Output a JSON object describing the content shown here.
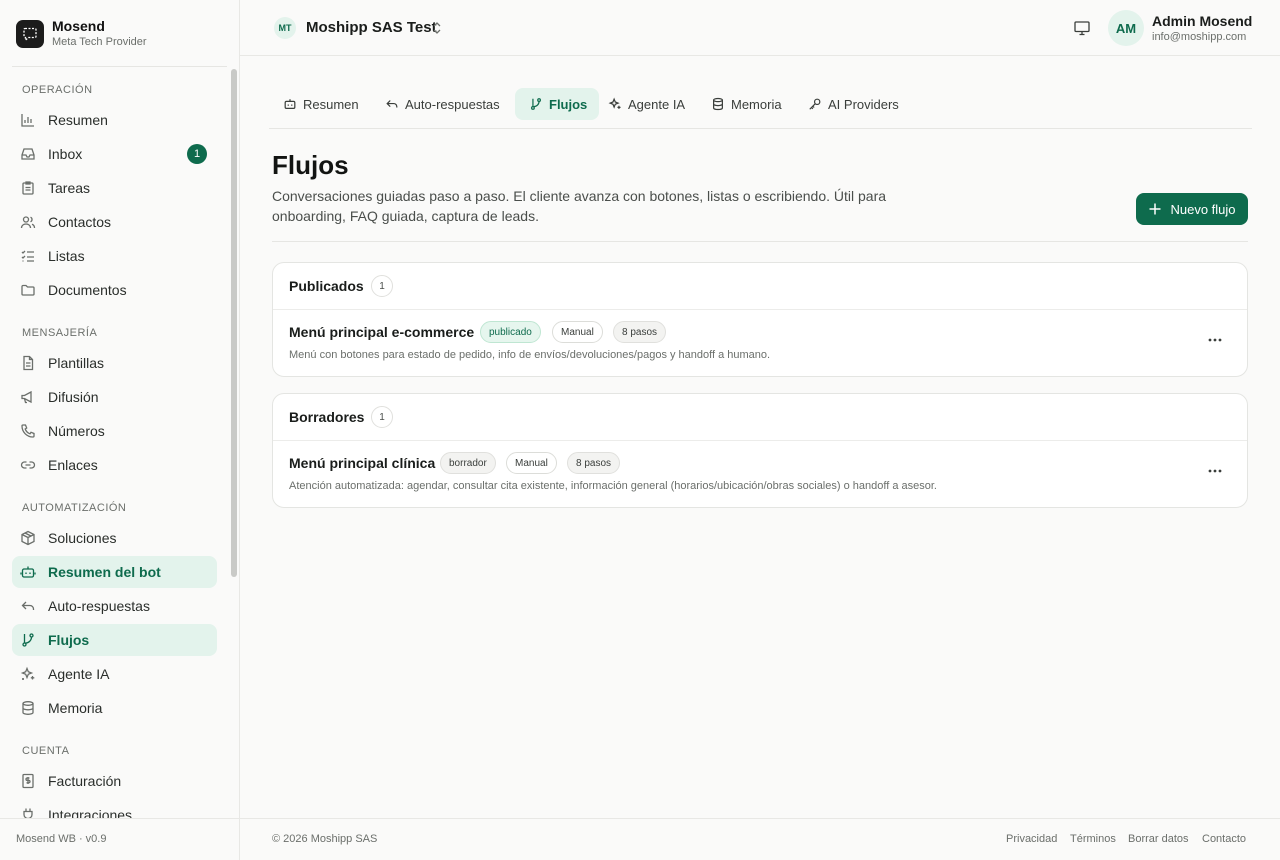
{
  "brand": {
    "name": "Mosend",
    "subtitle": "Meta Tech Provider",
    "logo_icon": "chat-square-icon"
  },
  "sidebar": {
    "sections": [
      {
        "label": "OPERACIÓN"
      },
      {
        "label": "MENSAJERÍA"
      },
      {
        "label": "AUTOMATIZACIÓN"
      },
      {
        "label": "CUENTA"
      }
    ],
    "items": [
      {
        "label": "Resumen",
        "icon": "bar-chart-icon"
      },
      {
        "label": "Inbox",
        "icon": "inbox-icon",
        "badge": "1"
      },
      {
        "label": "Tareas",
        "icon": "clipboard-icon"
      },
      {
        "label": "Contactos",
        "icon": "users-icon"
      },
      {
        "label": "Listas",
        "icon": "checklist-icon"
      },
      {
        "label": "Documentos",
        "icon": "folder-icon"
      },
      {
        "label": "Plantillas",
        "icon": "file-text-icon"
      },
      {
        "label": "Difusión",
        "icon": "megaphone-icon"
      },
      {
        "label": "Números",
        "icon": "phone-icon"
      },
      {
        "label": "Enlaces",
        "icon": "link-icon"
      },
      {
        "label": "Soluciones",
        "icon": "package-icon"
      },
      {
        "label": "Resumen del bot",
        "icon": "bot-icon",
        "active": true
      },
      {
        "label": "Auto-respuestas",
        "icon": "reply-icon"
      },
      {
        "label": "Flujos",
        "icon": "git-branch-icon",
        "active": true
      },
      {
        "label": "Agente IA",
        "icon": "sparkles-icon"
      },
      {
        "label": "Memoria",
        "icon": "database-icon"
      },
      {
        "label": "Facturación",
        "icon": "receipt-icon"
      },
      {
        "label": "Integraciones",
        "icon": "plug-icon"
      }
    ],
    "footer": "Mosend WB · v0.9"
  },
  "header": {
    "org_initials": "MT",
    "org_name": "Moshipp SAS Test",
    "user_initials": "AM",
    "user_name": "Admin Mosend",
    "user_email": "info@moshipp.com"
  },
  "tabs": [
    {
      "label": "Resumen",
      "icon": "bot-icon"
    },
    {
      "label": "Auto-respuestas",
      "icon": "reply-icon"
    },
    {
      "label": "Flujos",
      "icon": "git-branch-icon",
      "active": true
    },
    {
      "label": "Agente IA",
      "icon": "sparkles-icon"
    },
    {
      "label": "Memoria",
      "icon": "database-icon"
    },
    {
      "label": "AI Providers",
      "icon": "key-icon"
    }
  ],
  "page": {
    "title": "Flujos",
    "description": "Conversaciones guiadas paso a paso. El cliente avanza con botones, listas o escribiendo. Útil para onboarding, FAQ guiada, captura de leads.",
    "new_button": "Nuevo flujo"
  },
  "groups": {
    "published": {
      "title": "Publicados",
      "count": "1",
      "flows": [
        {
          "name": "Menú principal e-commerce",
          "status": "publicado",
          "trigger": "Manual",
          "steps": "8 pasos",
          "description": "Menú con botones para estado de pedido, info de envíos/devoluciones/pagos y handoff a humano."
        }
      ]
    },
    "drafts": {
      "title": "Borradores",
      "count": "1",
      "flows": [
        {
          "name": "Menú principal clínica",
          "status": "borrador",
          "trigger": "Manual",
          "steps": "8 pasos",
          "description": "Atención automatizada: agendar, consultar cita existente, información general (horarios/ubicación/obras sociales) o handoff a asesor."
        }
      ]
    }
  },
  "footer": {
    "copyright": "© 2026 Moshipp SAS",
    "links": [
      "Privacidad",
      "Términos",
      "Borrar datos",
      "Contacto"
    ]
  },
  "colors": {
    "accent": "#0e6b4d",
    "accent_soft": "#e3f3ec"
  }
}
